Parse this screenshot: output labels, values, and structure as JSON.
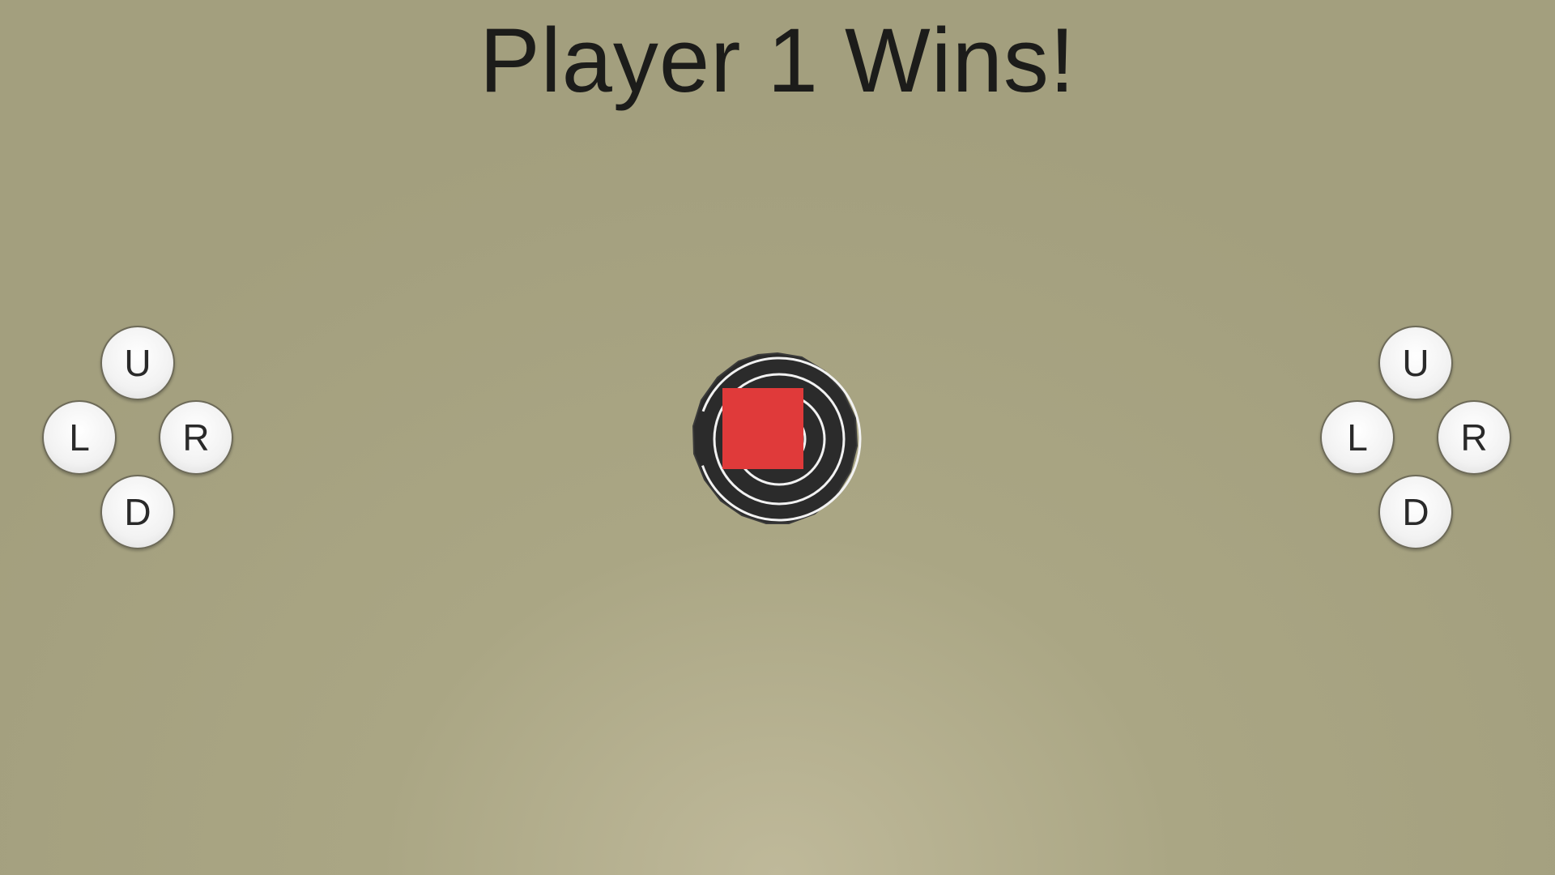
{
  "game": {
    "status_text": "Player 1 Wins!"
  },
  "controls": {
    "left_pad": {
      "up": "U",
      "left": "L",
      "right": "R",
      "down": "D"
    },
    "right_pad": {
      "up": "U",
      "left": "L",
      "right": "R",
      "down": "D"
    }
  },
  "colors": {
    "background": "#a39f7e",
    "player": "#e03a3a",
    "target": "#2b2b2b",
    "target_rings": "#f2f2f2"
  },
  "icons": {
    "target": "spiral-target-icon",
    "player": "red-square-player"
  }
}
